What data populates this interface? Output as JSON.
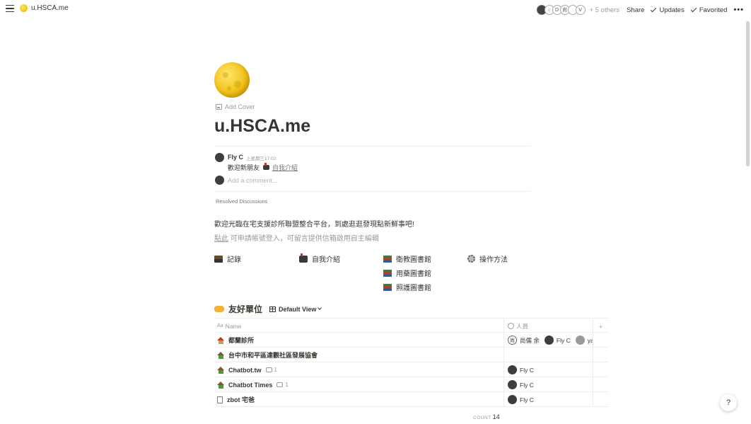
{
  "topbar": {
    "page_title": "u.HSCA.me",
    "others_label": "+ 5 others",
    "share_label": "Share",
    "updates_label": "Updates",
    "favorited_label": "Favorited",
    "more_label": "•••",
    "avatar_letters": [
      "",
      "○",
      "D",
      "尚",
      "",
      "V"
    ]
  },
  "page": {
    "icon": "full-moon-icon",
    "add_cover_label": "Add Cover",
    "title": "u.HSCA.me"
  },
  "discussion": {
    "author": "Fly C",
    "time": "上星期三17:02",
    "text": "歡迎新朋友",
    "link_text": "自我介紹",
    "add_comment_placeholder": "Add a comment...",
    "resolved_label": "Resolved Discussions"
  },
  "intro": {
    "line1": "歡迎光臨在宅支援診所聯盟整合平台，到處逛逛發現點新鮮事吧!",
    "line2_link": "點此",
    "line2_rest": " 可申請帳號登入，可留言提供信箱啟用自主編輯"
  },
  "nav_links": {
    "records": "記錄",
    "self_intro": "自我介紹",
    "health_library": "衛教圖書館",
    "drug_library": "用藥圖書館",
    "care_library": "照護圖書館",
    "how_to": "操作方法"
  },
  "database": {
    "title": "友好單位",
    "view_label": "Default View",
    "columns": {
      "name": "Name",
      "people": "人員",
      "add": "+"
    },
    "rows": [
      {
        "name": "都蘭診所",
        "comments": "",
        "people": [
          "尚儒 余",
          "Fly C",
          "ya"
        ]
      },
      {
        "name": "台中市和平區達觀社區發展協會",
        "comments": "",
        "people": []
      },
      {
        "name": "Chatbot.tw",
        "comments": "1",
        "people": [
          "Fly C"
        ]
      },
      {
        "name": "Chatbot Times",
        "comments": "1",
        "people": [
          "Fly C"
        ]
      },
      {
        "name": "zbot 宅爸",
        "comments": "",
        "people": [
          "Fly C"
        ]
      }
    ],
    "count_label": "COUNT",
    "count_value": "14"
  },
  "help_label": "?"
}
